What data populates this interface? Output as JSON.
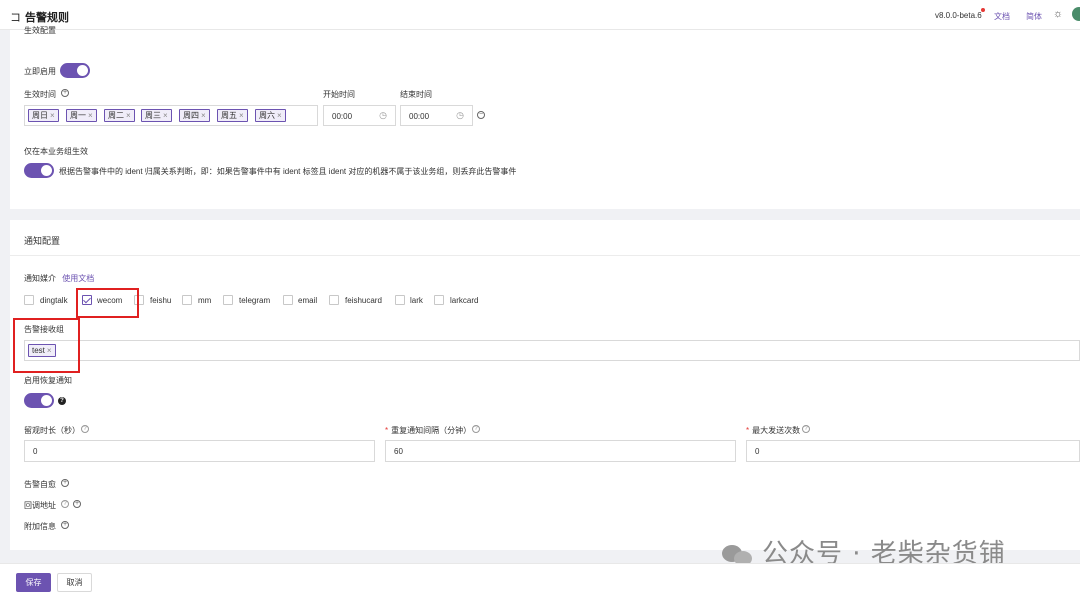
{
  "header": {
    "title": "告警规则",
    "back_glyph": "コ",
    "version": "v8.0.0-beta.6",
    "docs_link": "文档",
    "language": "简体",
    "theme_icon": "sun-icon"
  },
  "effective": {
    "section_title_cut": "生效配置",
    "enable_label": "立即启用",
    "enable_on": true,
    "time_label": "生效时间",
    "start_time_label": "开始时间",
    "end_time_label": "结束时间",
    "weekdays": [
      "周日",
      "周一",
      "周二",
      "周三",
      "周四",
      "周五",
      "周六"
    ],
    "start_time": "00:00",
    "end_time": "00:00",
    "biz_only_label": "仅在本业务组生效",
    "biz_only_desc": "根据告警事件中的 ident 归属关系判断，即：如果告警事件中有 ident 标签且 ident 对应的机器不属于该业务组，则丢弃此告警事件",
    "biz_only_on": true
  },
  "notify": {
    "section_title": "通知配置",
    "media_label": "通知媒介",
    "media_doc_link": "使用文档",
    "channels": [
      {
        "name": "dingtalk",
        "checked": false
      },
      {
        "name": "wecom",
        "checked": true
      },
      {
        "name": "feishu",
        "checked": false
      },
      {
        "name": "mm",
        "checked": false
      },
      {
        "name": "telegram",
        "checked": false
      },
      {
        "name": "email",
        "checked": false
      },
      {
        "name": "feishucard",
        "checked": false
      },
      {
        "name": "lark",
        "checked": false
      },
      {
        "name": "larkcard",
        "checked": false
      }
    ],
    "receiver_label": "告警接收组",
    "receiver_tags": [
      "test"
    ],
    "recover_label": "启用恢复通知",
    "recover_on": true,
    "observe_label": "留观时长（秒）",
    "observe_value": "0",
    "repeat_label": "重复通知间隔（分钟）",
    "repeat_value": "60",
    "max_send_label": "最大发送次数",
    "max_send_value": "0",
    "self_heal_label": "告警自愈",
    "callback_label": "回调地址",
    "extra_label": "附加信息"
  },
  "footer": {
    "save": "保存",
    "cancel": "取消"
  },
  "watermark": {
    "text": "公众号 · 老柴杂货铺"
  },
  "colors": {
    "accent": "#6c53b1",
    "highlight_box": "#e02020",
    "required": "#e53935"
  }
}
